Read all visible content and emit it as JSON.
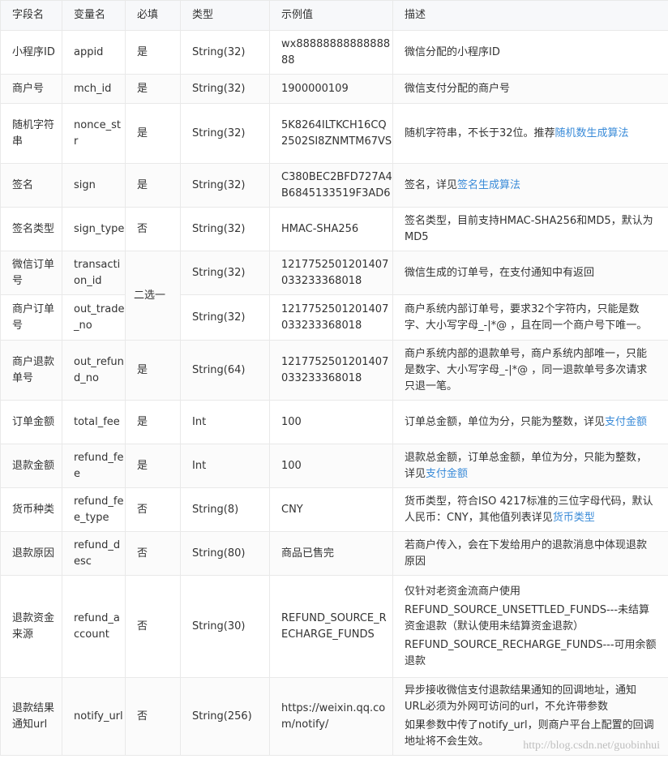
{
  "headers": [
    "字段名",
    "变量名",
    "必填",
    "类型",
    "示例值",
    "描述"
  ],
  "rows": [
    {
      "field": "小程序ID",
      "var": "appid",
      "required": "是",
      "type": "String(32)",
      "example": "wx8888888888888888",
      "desc": [
        {
          "text": "微信分配的小程序ID"
        }
      ]
    },
    {
      "field": "商户号",
      "var": "mch_id",
      "required": "是",
      "type": "String(32)",
      "example": "1900000109",
      "desc": [
        {
          "text": "微信支付分配的商户号"
        }
      ]
    },
    {
      "field": "随机字符串",
      "var": "nonce_str",
      "required": "是",
      "type": "String(32)",
      "example": "5K8264ILTKCH16CQ2502SI8ZNMTM67VS",
      "desc": [
        {
          "text": "随机字符串，不长于32位。推荐"
        },
        {
          "text": "随机数生成算法",
          "link": true
        }
      ]
    },
    {
      "field": "签名",
      "var": "sign",
      "required": "是",
      "type": "String(32)",
      "example": "C380BEC2BFD727A4B6845133519F3AD6",
      "desc": [
        {
          "text": "签名，详见"
        },
        {
          "text": "签名生成算法",
          "link": true
        }
      ]
    },
    {
      "field": "签名类型",
      "var": "sign_type",
      "required": "否",
      "type": "String(32)",
      "example": "HMAC-SHA256",
      "desc": [
        {
          "text": "签名类型，目前支持HMAC-SHA256和MD5，默认为MD5"
        }
      ]
    },
    {
      "field": "微信订单号",
      "var": "transaction_id",
      "required": "二选一",
      "required_rowspan": 2,
      "type": "String(32)",
      "example": "1217752501201407033233368018",
      "desc": [
        {
          "text": "微信生成的订单号，在支付通知中有返回"
        }
      ]
    },
    {
      "field": "商户订单号",
      "var": "out_trade_no",
      "type": "String(32)",
      "example": "1217752501201407033233368018",
      "desc": [
        {
          "text": "商户系统内部订单号，要求32个字符内，只能是数字、大小写字母_-|*@ ，且在同一个商户号下唯一。"
        }
      ]
    },
    {
      "field": "商户退款单号",
      "var": "out_refund_no",
      "required": "是",
      "type": "String(64)",
      "example": "1217752501201407033233368018",
      "desc": [
        {
          "text": "商户系统内部的退款单号，商户系统内部唯一，只能是数字、大小写字母_-|*@ ，同一退款单号多次请求只退一笔。"
        }
      ]
    },
    {
      "field": "订单金额",
      "var": "total_fee",
      "required": "是",
      "type": "Int",
      "example": "100",
      "desc": [
        {
          "text": "订单总金额，单位为分，只能为整数，详见"
        },
        {
          "text": "支付金额",
          "link": true
        }
      ]
    },
    {
      "field": "退款金额",
      "var": "refund_fee",
      "required": "是",
      "type": "Int",
      "example": "100",
      "desc": [
        {
          "text": "退款总金额，订单总金额，单位为分，只能为整数，详见"
        },
        {
          "text": "支付金额",
          "link": true
        }
      ]
    },
    {
      "field": "货币种类",
      "var": "refund_fee_type",
      "required": "否",
      "type": "String(8)",
      "example": "CNY",
      "desc": [
        {
          "text": "货币类型，符合ISO 4217标准的三位字母代码，默认人民币：CNY，其他值列表详见"
        },
        {
          "text": "货币类型",
          "link": true
        }
      ]
    },
    {
      "field": "退款原因",
      "var": "refund_desc",
      "required": "否",
      "type": "String(80)",
      "example": "商品已售完",
      "desc": [
        {
          "text": "若商户传入，会在下发给用户的退款消息中体现退款原因"
        }
      ]
    },
    {
      "field": "退款资金来源",
      "var": "refund_account",
      "required": "否",
      "type": "String(30)",
      "example": "REFUND_SOURCE_RECHARGE_FUNDS",
      "desc": [
        {
          "text": "仅针对老资金流商户使用",
          "para": true
        },
        {
          "text": "REFUND_SOURCE_UNSETTLED_FUNDS---未结算资金退款（默认使用未结算资金退款）",
          "para": true
        },
        {
          "text": "REFUND_SOURCE_RECHARGE_FUNDS---可用余额退款",
          "para": true
        }
      ]
    },
    {
      "field": "退款结果通知url",
      "var": "notify_url",
      "required": "否",
      "type": "String(256)",
      "example": "https://weixin.qq.com/notify/",
      "desc": [
        {
          "text": "异步接收微信支付退款结果通知的回调地址，通知URL必须为外网可访问的url，不允许带参数",
          "para": true
        },
        {
          "text": "如果参数中传了notify_url，则商户平台上配置的回调地址将不会生效。",
          "para": true
        }
      ]
    }
  ],
  "watermark": "http://blog.csdn.net/guobinhui"
}
